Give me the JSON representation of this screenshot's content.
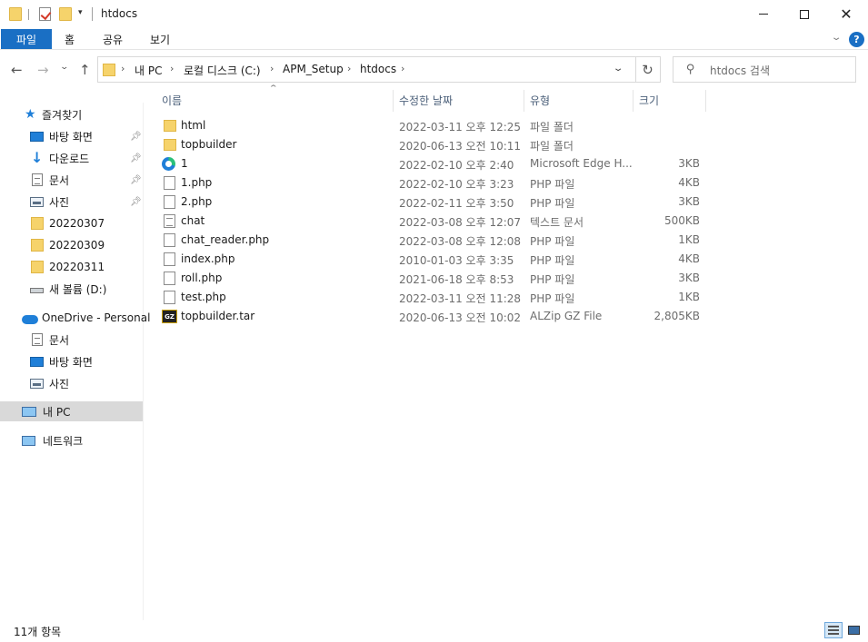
{
  "window": {
    "title": "htdocs",
    "quick_access_dropdown": "▾"
  },
  "ribbon": {
    "tabs": [
      "파일",
      "홈",
      "공유",
      "보기"
    ],
    "help": "?"
  },
  "navigation": {
    "breadcrumb": [
      "내 PC",
      "로컬 디스크 (C:)",
      "APM_Setup",
      "htdocs"
    ],
    "search_placeholder": "htdocs 검색"
  },
  "sidebar": {
    "quick_access_label": "즐겨찾기",
    "quick_access_items": [
      {
        "label": "바탕 화면",
        "icon": "desktop-icon",
        "pinned": true
      },
      {
        "label": "다운로드",
        "icon": "download-icon",
        "pinned": true
      },
      {
        "label": "문서",
        "icon": "document-icon",
        "pinned": true
      },
      {
        "label": "사진",
        "icon": "pictures-icon",
        "pinned": true
      },
      {
        "label": "20220307",
        "icon": "folder-icon",
        "pinned": false
      },
      {
        "label": "20220309",
        "icon": "folder-icon",
        "pinned": false
      },
      {
        "label": "20220311",
        "icon": "folder-icon",
        "pinned": false
      },
      {
        "label": "새 볼륨 (D:)",
        "icon": "drive-icon",
        "pinned": false
      }
    ],
    "onedrive_label": "OneDrive - Personal",
    "onedrive_items": [
      {
        "label": "문서",
        "icon": "document-icon"
      },
      {
        "label": "바탕 화면",
        "icon": "desktop-icon"
      },
      {
        "label": "사진",
        "icon": "pictures-icon"
      }
    ],
    "this_pc_label": "내 PC",
    "network_label": "네트워크"
  },
  "columns": {
    "name": "이름",
    "modified": "수정한 날짜",
    "type": "유형",
    "size": "크기"
  },
  "files": [
    {
      "name": "html",
      "modified": "2022-03-11 오후 12:25",
      "type": "파일 폴더",
      "size": "",
      "icon": "folder-icon"
    },
    {
      "name": "topbuilder",
      "modified": "2020-06-13 오전 10:11",
      "type": "파일 폴더",
      "size": "",
      "icon": "folder-icon"
    },
    {
      "name": "1",
      "modified": "2022-02-10 오후 2:40",
      "type": "Microsoft Edge H...",
      "size": "3KB",
      "icon": "edge-icon"
    },
    {
      "name": "1.php",
      "modified": "2022-02-10 오후 3:23",
      "type": "PHP 파일",
      "size": "4KB",
      "icon": "file-icon"
    },
    {
      "name": "2.php",
      "modified": "2022-02-11 오후 3:50",
      "type": "PHP 파일",
      "size": "3KB",
      "icon": "file-icon"
    },
    {
      "name": "chat",
      "modified": "2022-03-08 오후 12:07",
      "type": "텍스트 문서",
      "size": "500KB",
      "icon": "text-file-icon"
    },
    {
      "name": "chat_reader.php",
      "modified": "2022-03-08 오후 12:08",
      "type": "PHP 파일",
      "size": "1KB",
      "icon": "file-icon"
    },
    {
      "name": "index.php",
      "modified": "2010-01-03 오후 3:35",
      "type": "PHP 파일",
      "size": "4KB",
      "icon": "file-icon"
    },
    {
      "name": "roll.php",
      "modified": "2021-06-18 오후 8:53",
      "type": "PHP 파일",
      "size": "3KB",
      "icon": "file-icon"
    },
    {
      "name": "test.php",
      "modified": "2022-03-11 오전 11:28",
      "type": "PHP 파일",
      "size": "1KB",
      "icon": "file-icon"
    },
    {
      "name": "topbuilder.tar",
      "modified": "2020-06-13 오전 10:02",
      "type": "ALZip GZ File",
      "size": "2,805KB",
      "icon": "gz-archive-icon",
      "badge": "GZ"
    }
  ],
  "status": {
    "item_count": "11개 항목"
  },
  "colors": {
    "accent": "#1a6fc4",
    "folder": "#f6d36b",
    "selected_nav": "#d9d9d9"
  }
}
